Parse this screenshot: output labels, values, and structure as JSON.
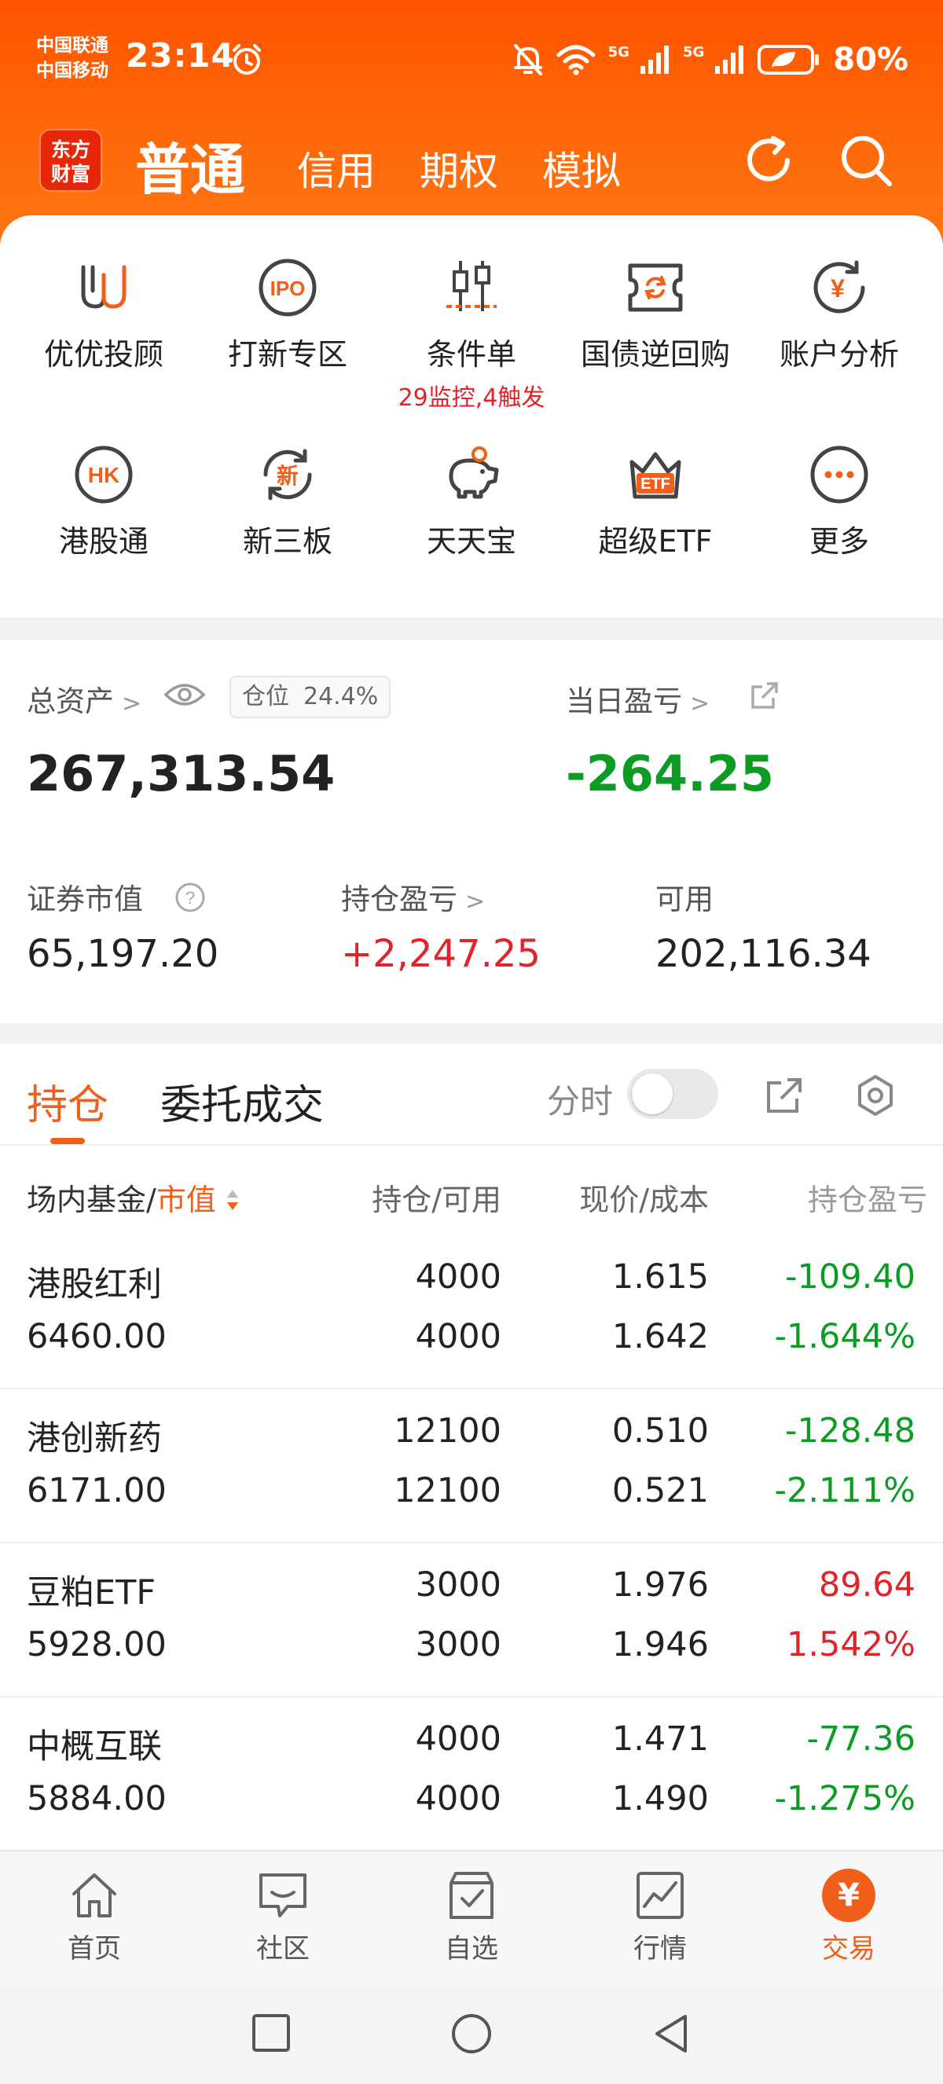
{
  "status_bar": {
    "carrier1": "中国联通",
    "carrier2": "中国移动",
    "time": "23:14",
    "net1": "5G",
    "net2": "5G",
    "battery": "80%"
  },
  "header": {
    "logo_line1": "东方",
    "logo_line2": "财富",
    "tabs": [
      "普通",
      "信用",
      "期权",
      "模拟"
    ],
    "active_tab": "普通"
  },
  "quick_grid": [
    {
      "label": "优优投顾",
      "icon": "youyou-icon"
    },
    {
      "label": "打新专区",
      "icon": "ipo-icon"
    },
    {
      "label": "条件单",
      "icon": "candlestick-icon",
      "sub": "29监控,4触发"
    },
    {
      "label": "国债逆回购",
      "icon": "bond-repo-icon"
    },
    {
      "label": "账户分析",
      "icon": "yen-analysis-icon"
    },
    {
      "label": "港股通",
      "icon": "hk-icon"
    },
    {
      "label": "新三板",
      "icon": "xin-icon"
    },
    {
      "label": "天天宝",
      "icon": "piggy-icon"
    },
    {
      "label": "超级ETF",
      "icon": "etf-crown-icon"
    },
    {
      "label": "更多",
      "icon": "more-icon"
    }
  ],
  "assets": {
    "total_label": "总资产",
    "position_label": "仓位",
    "position_value": "24.4%",
    "total_value": "267,313.54",
    "daily_pl_label": "当日盈亏",
    "daily_pl_value": "-264.25",
    "securities_label": "证券市值",
    "securities_value": "65,197.20",
    "holding_pl_label": "持仓盈亏",
    "holding_pl_value": "+2,247.25",
    "available_label": "可用",
    "available_value": "202,116.34"
  },
  "holdings": {
    "tab_positions": "持仓",
    "tab_orders": "委托成交",
    "fenshi_label": "分时",
    "fenshi_on": false,
    "col_name_a": "场内基金/",
    "col_name_b": "市值",
    "col_qty": "持仓/可用",
    "col_price": "现价/成本",
    "col_pl": "持仓盈亏",
    "rows": [
      {
        "name": "港股红利",
        "market_value": "6460.00",
        "qty": "4000",
        "avail": "4000",
        "price": "1.615",
        "cost": "1.642",
        "pl": "-109.40",
        "pl_pct": "-1.644%",
        "dir": "down"
      },
      {
        "name": "港创新药",
        "market_value": "6171.00",
        "qty": "12100",
        "avail": "12100",
        "price": "0.510",
        "cost": "0.521",
        "pl": "-128.48",
        "pl_pct": "-2.111%",
        "dir": "down"
      },
      {
        "name": "豆粕ETF",
        "market_value": "5928.00",
        "qty": "3000",
        "avail": "3000",
        "price": "1.976",
        "cost": "1.946",
        "pl": "89.64",
        "pl_pct": "1.542%",
        "dir": "up"
      },
      {
        "name": "中概互联",
        "market_value": "5884.00",
        "qty": "4000",
        "avail": "4000",
        "price": "1.471",
        "cost": "1.490",
        "pl": "-77.36",
        "pl_pct": "-1.275%",
        "dir": "down"
      }
    ]
  },
  "bottom_nav": [
    {
      "label": "首页",
      "icon": "home-icon"
    },
    {
      "label": "社区",
      "icon": "community-icon"
    },
    {
      "label": "自选",
      "icon": "watchlist-icon"
    },
    {
      "label": "行情",
      "icon": "market-icon"
    },
    {
      "label": "交易",
      "icon": "trade-icon",
      "glyph": "¥"
    }
  ],
  "colors": {
    "brand_orange": "#ff5a00",
    "accent": "#f1601a",
    "up_red": "#e0242a",
    "down_green": "#0c9c23"
  }
}
